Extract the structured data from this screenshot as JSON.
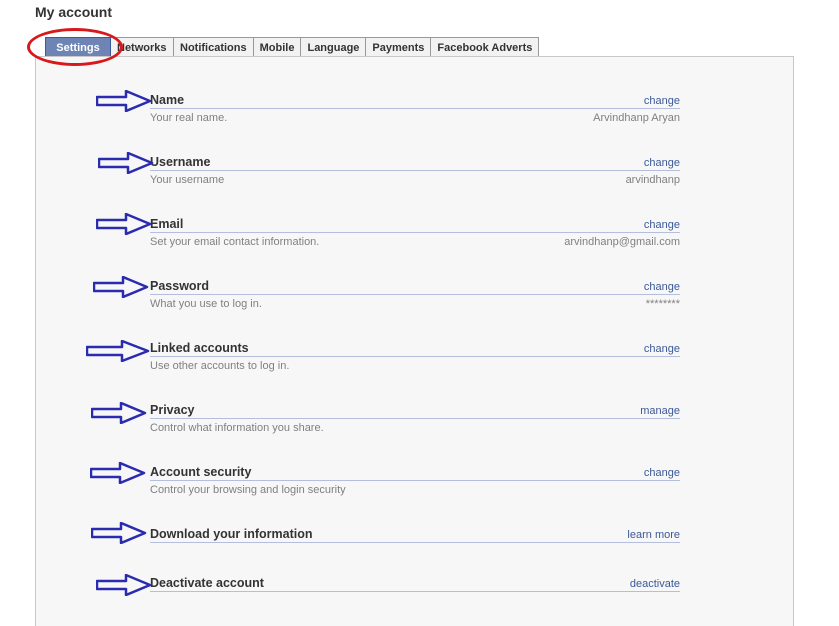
{
  "page": {
    "title": "My account"
  },
  "tabs": [
    {
      "label": "Settings"
    },
    {
      "label": "Networks"
    },
    {
      "label": "Notifications"
    },
    {
      "label": "Mobile"
    },
    {
      "label": "Language"
    },
    {
      "label": "Payments"
    },
    {
      "label": "Facebook Adverts"
    }
  ],
  "settings": [
    {
      "title": "Name",
      "description": "Your real name.",
      "action": "change",
      "value": "Arvindhanp Aryan"
    },
    {
      "title": "Username",
      "description": "Your username",
      "action": "change",
      "value": "arvindhanp"
    },
    {
      "title": "Email",
      "description": "Set your email contact information.",
      "action": "change",
      "value": "arvindhanp@gmail.com"
    },
    {
      "title": "Password",
      "description": "What you use to log in.",
      "action": "change",
      "value": "********"
    },
    {
      "title": "Linked accounts",
      "description": "Use other accounts to log in.",
      "action": "change"
    },
    {
      "title": "Privacy",
      "description": "Control what information you share.",
      "action": "manage"
    },
    {
      "title": "Account security",
      "description": "Control your browsing and login security",
      "action": "change"
    },
    {
      "title": "Download your information",
      "action": "learn more"
    },
    {
      "title": "Deactivate account",
      "action": "deactivate"
    }
  ],
  "colors": {
    "annotation_ellipse": "#d7191c",
    "annotation_arrow": "#2b2bb0",
    "link": "#3b5998",
    "active_tab": "#6d84b4"
  }
}
